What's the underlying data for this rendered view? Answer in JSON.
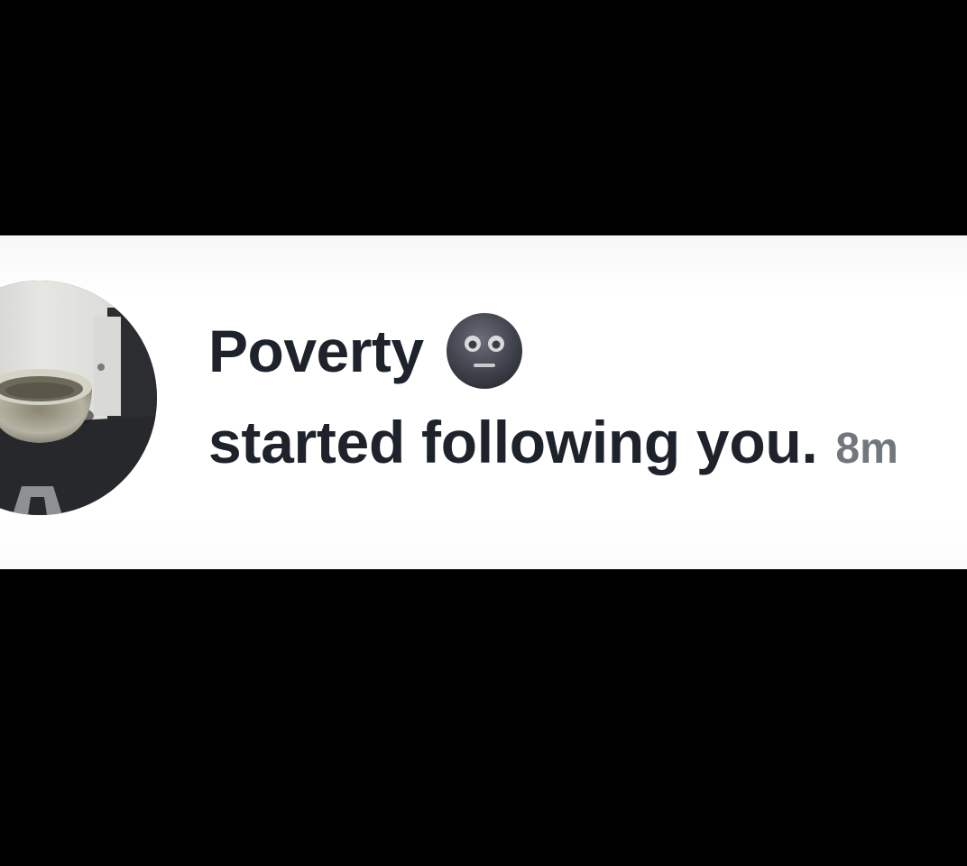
{
  "notification": {
    "username": "Poverty",
    "status_emoji": "neutral-face-emoji-icon",
    "action_text": "started following you.",
    "timestamp": "8m"
  },
  "colors": {
    "background": "#ffffff",
    "letterbox": "#000000",
    "primary_text": "#1e232b",
    "secondary_text": "#72767d"
  }
}
